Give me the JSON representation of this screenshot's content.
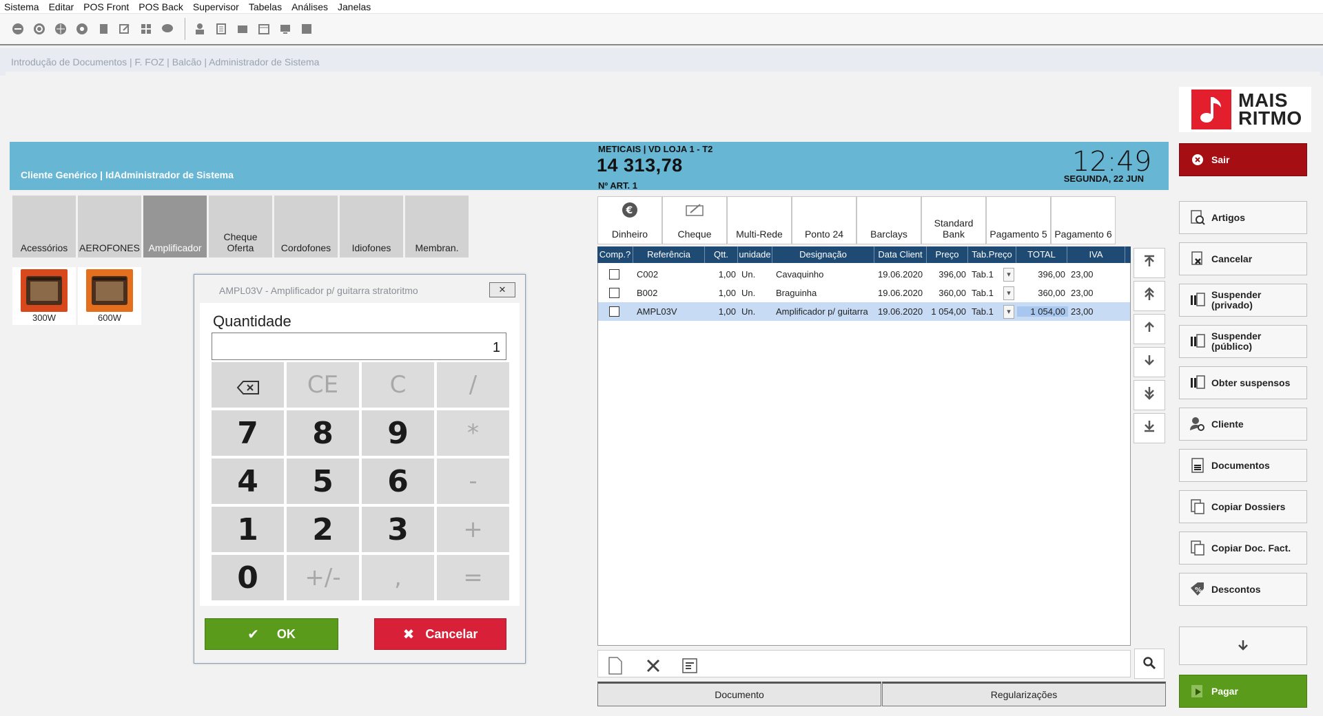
{
  "menu": [
    "Sistema",
    "Editar",
    "POS Front",
    "POS Back",
    "Supervisor",
    "Tabelas",
    "Análises",
    "Janelas"
  ],
  "breadcrumb": "Introdução de Documentos | F. FOZ | Balcão | Administrador de Sistema",
  "header": {
    "client": "Cliente Genérico | IdAdministrador de Sistema",
    "title": "METICAIS | VD LOJA 1 - T2",
    "total": "14 313,78",
    "num_art": "Nº ART. 1",
    "time": "12:49",
    "date": "SEGUNDA, 22 JUN"
  },
  "logo": {
    "line1": "MAIS",
    "line2": "RITMO",
    "color": "#e31e2d"
  },
  "categories": [
    "Acessórios",
    "AEROFONES",
    "Amplificador",
    "Cheque\nOferta",
    "Cordofones",
    "Idiofones",
    "Membran."
  ],
  "selected_category": "Amplificador",
  "products": [
    {
      "label": "300W",
      "color": "#d7481c"
    },
    {
      "label": "600W",
      "color": "#e46f1c"
    }
  ],
  "payments": [
    "Dinheiro",
    "Cheque",
    "Multi-Rede",
    "Ponto 24",
    "Barclays",
    "Standard\nBank",
    "Pagamento 5",
    "Pagamento 6"
  ],
  "table": {
    "columns": [
      "Comp.?",
      "Referência",
      "Qtt.",
      "unidade",
      "Designação",
      "Data Client",
      "Preço",
      "Tab.Preço",
      "TOTAL",
      "IVA"
    ],
    "rows": [
      {
        "ref": "C002",
        "qtt": "1,00",
        "un": "Un.",
        "des": "Cavaquinho",
        "data": "19.06.2020",
        "preco": "396,00",
        "tab": "Tab.1",
        "total": "396,00",
        "iva": "23,00",
        "selected": false
      },
      {
        "ref": "B002",
        "qtt": "1,00",
        "un": "Un.",
        "des": "Braguinha",
        "data": "19.06.2020",
        "preco": "360,00",
        "tab": "Tab.1",
        "total": "360,00",
        "iva": "23,00",
        "selected": false
      },
      {
        "ref": "AMPL03V",
        "qtt": "1,00",
        "un": "Un.",
        "des": "Amplificador p/ guitarra",
        "data": "19.06.2020",
        "preco": "1 054,00",
        "tab": "Tab.1",
        "total": "1 054,00",
        "iva": "23,00",
        "selected": true
      }
    ]
  },
  "bottom_tabs": [
    "Documento",
    "Regularizações"
  ],
  "right_buttons": {
    "sair": "Sair",
    "artigos": "Artigos",
    "cancelar": "Cancelar",
    "susp_priv": "Suspender\n(privado)",
    "susp_pub": "Suspender\n(público)",
    "obter": "Obter suspensos",
    "cliente": "Cliente",
    "documentos": "Documentos",
    "copiar_dossiers": "Copiar Dossiers",
    "copiar_doc": "Copiar Doc. Fact.",
    "descontos": "Descontos",
    "pagar": "Pagar"
  },
  "dialog": {
    "title": "AMPL03V - Amplificador p/ guitarra stratoritmo",
    "label": "Quantidade",
    "value": "1",
    "keys": [
      "⌫",
      "CE",
      "C",
      "/",
      "7",
      "8",
      "9",
      "*",
      "4",
      "5",
      "6",
      "-",
      "1",
      "2",
      "3",
      "+",
      "0",
      "+/-",
      ",",
      "="
    ],
    "ok": "OK",
    "cancel": "Cancelar"
  },
  "colors": {
    "band": "#67b6d3",
    "sair": "#a50f14",
    "pagar": "#5b9b1b",
    "ok": "#5b9b1b",
    "cancel": "#d82138",
    "table_header": "#1e4a73"
  }
}
